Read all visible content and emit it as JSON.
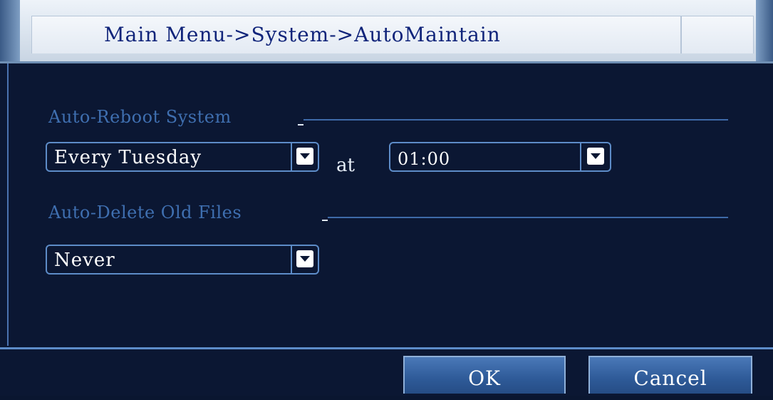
{
  "window": {
    "breadcrumb": "Main Menu->System->AutoMaintain"
  },
  "auto_reboot": {
    "label": "Auto-Reboot System",
    "frequency": "Every Tuesday",
    "at_label": "at",
    "time": "01:00"
  },
  "auto_delete": {
    "label": "Auto-Delete Old Files",
    "value": "Never"
  },
  "buttons": {
    "ok": "OK",
    "cancel": "Cancel"
  },
  "colors": {
    "background": "#0b1733",
    "accent_blue": "#5d8cc8",
    "label_blue": "#3f6fb0",
    "title_text": "#10247a"
  },
  "icons": {
    "dropdown_arrow": "chevron-down-icon"
  }
}
